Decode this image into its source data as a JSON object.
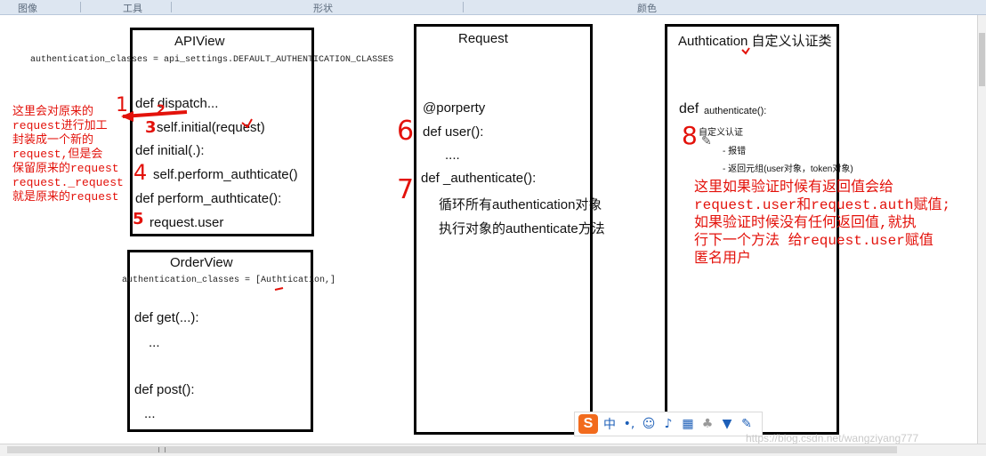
{
  "toolbar": {
    "items": [
      "图像",
      "工具",
      "形状",
      "颜色"
    ]
  },
  "apiview": {
    "title": "APIView",
    "config_line": "authentication_classes = api_settings.DEFAULT_AUTHENTICATION_CLASSES",
    "lines": [
      "def dispatch...",
      "self.initial(request)",
      "def initial(.):",
      "self.perform_authticate()",
      "def perform_authticate():",
      "request.user"
    ]
  },
  "orderview": {
    "title": "OrderView",
    "config_line": "authentication_classes = [Authtication,]",
    "lines": [
      "def get(...):",
      "...",
      "def post():",
      "..."
    ]
  },
  "request_box": {
    "title": "Request",
    "lines": [
      "@porperty",
      "def user():",
      "....",
      "def _authenticate():",
      "循环所有authentication对象",
      "执行对象的authenticate方法"
    ]
  },
  "auth_box": {
    "title": "Authtication 自定义认证类",
    "def_keyword": "def",
    "method": "authenticate():",
    "items": [
      "自定义认证",
      "- 报错",
      "- 返回元组(user对象，token对象)"
    ]
  },
  "annotations": {
    "left_note": [
      "这里会对原来的",
      "request进行加工",
      "封装成一个新的",
      "request,但是会",
      "保留原来的request",
      "request._request",
      "就是原来的request"
    ],
    "right_note": [
      "这里如果验证时候有返回值会给",
      "request.user和request.auth赋值;",
      "如果验证时候没有任何返回值,就执",
      "行下一个方法   给request.user赋值",
      "匿名用户"
    ],
    "step_numbers": [
      "1",
      "2",
      "3",
      "4",
      "5",
      "6",
      "7",
      "8"
    ]
  },
  "ime_toolbar": {
    "logo": "S",
    "lang": "中",
    "icons": [
      "punctuation-icon",
      "emoji-icon",
      "mic-icon",
      "keyboard-icon",
      "skin-icon",
      "shirt-icon",
      "wrench-icon"
    ]
  },
  "watermark": "https://blog.csdn.net/wangziyang777",
  "colors": {
    "annotation": "#e3120b",
    "box_border": "#000000",
    "toolbar_bg": "#dde6f1"
  }
}
